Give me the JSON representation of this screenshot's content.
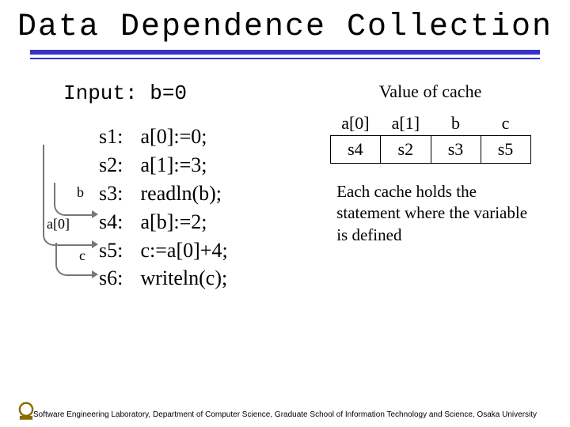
{
  "title": "Data Dependence Collection",
  "input_line": "Input: b=0",
  "statements": [
    {
      "label": "s1:",
      "code": "a[0]:=0;"
    },
    {
      "label": "s2:",
      "code": "a[1]:=3;"
    },
    {
      "label": "s3:",
      "code": "readln(b);"
    },
    {
      "label": "s4:",
      "code": "a[b]:=2;"
    },
    {
      "label": "s5:",
      "code": "c:=a[0]+4;"
    },
    {
      "label": "s6:",
      "code": "writeln(c);"
    }
  ],
  "edge_labels": {
    "b": "b",
    "a0": "a[0]",
    "c": "c"
  },
  "cache": {
    "heading": "Value of cache",
    "columns": [
      "a[0]",
      "a[1]",
      "b",
      "c"
    ],
    "values": [
      "s4",
      "s2",
      "s3",
      "s5"
    ]
  },
  "explanation": "Each cache holds the statement where the variable is defined",
  "footer": "Software Engineering Laboratory, Department of Computer Science, Graduate School of Information Technology and Science, Osaka University"
}
